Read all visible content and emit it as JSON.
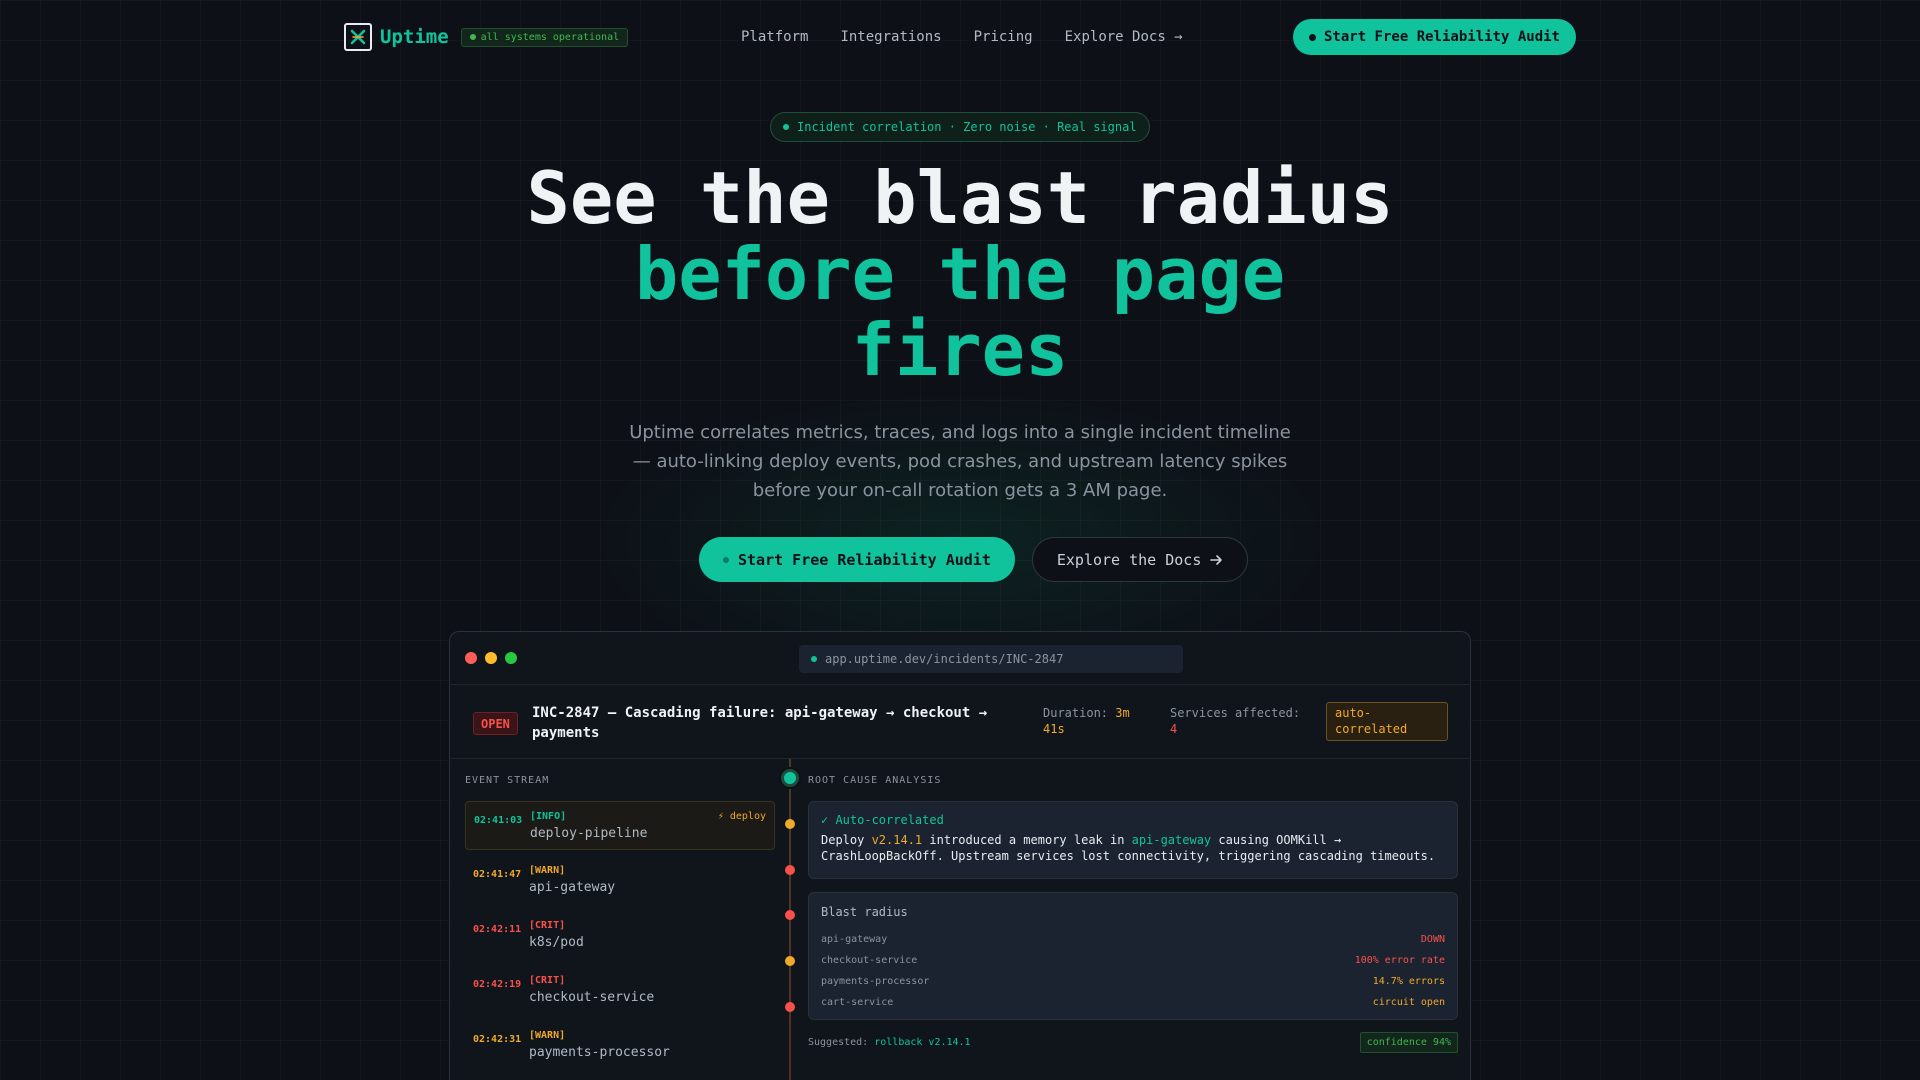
{
  "nav": {
    "brand": "Uptime",
    "status": "all systems operational",
    "links": [
      "Platform",
      "Integrations",
      "Pricing",
      "Explore Docs →"
    ],
    "cta": "Start Free Reliability Audit"
  },
  "hero": {
    "tag": "Incident correlation · Zero noise · Real signal",
    "title_line1": "See the blast radius",
    "title_line2": "before the page",
    "title_line3": "fires",
    "subtitle": "Uptime correlates metrics, traces, and logs into a single incident timeline — auto-linking deploy events, pod crashes, and upstream latency spikes before your on-call rotation gets a 3 AM page.",
    "cta_primary": "Start Free Reliability Audit",
    "cta_secondary": "Explore the Docs"
  },
  "window": {
    "url": "app.uptime.dev/incidents/INC-2847",
    "incident": {
      "status": "OPEN",
      "title": "INC-2847 — Cascading failure: api-gateway → checkout → payments",
      "duration_label": "Duration:",
      "duration_value": "3m 41s",
      "services_label": "Services affected:",
      "services_value": "4",
      "badge": "auto-correlated"
    },
    "event_stream_label": "EVENT STREAM",
    "rca_label": "ROOT CAUSE ANALYSIS",
    "events": [
      {
        "time": "02:41:03",
        "level": "[INFO]",
        "source": "deploy-pipeline",
        "tag": "⚡ deploy"
      },
      {
        "time": "02:41:47",
        "level": "[WARN]",
        "source": "api-gateway"
      },
      {
        "time": "02:42:11",
        "level": "[CRIT]",
        "source": "k8s/pod"
      },
      {
        "time": "02:42:19",
        "level": "[CRIT]",
        "source": "checkout-service"
      },
      {
        "time": "02:42:31",
        "level": "[WARN]",
        "source": "payments-processor"
      }
    ],
    "rca": {
      "heading": "✓ Auto-correlated",
      "text_pre": "Deploy ",
      "version": "v2.14.1",
      "text_mid": " introduced a memory leak in ",
      "service": "api-gateway",
      "text_post": " causing OOMKill → CrashLoopBackOff. Upstream services lost connectivity, triggering cascading timeouts."
    },
    "blast": {
      "heading": "Blast radius",
      "rows": [
        {
          "service": "api-gateway",
          "state": "DOWN"
        },
        {
          "service": "checkout-service",
          "state": "100% error rate"
        },
        {
          "service": "payments-processor",
          "state": "14.7% errors"
        },
        {
          "service": "cart-service",
          "state": "circuit open"
        }
      ]
    },
    "suggested_label": "Suggested:",
    "suggested_value": "rollback v2.14.1",
    "confidence": "confidence 94%"
  },
  "colors": {
    "accent": "#10c39d",
    "warn": "#f0a92b",
    "crit": "#f85149",
    "bg": "#0d1117"
  }
}
